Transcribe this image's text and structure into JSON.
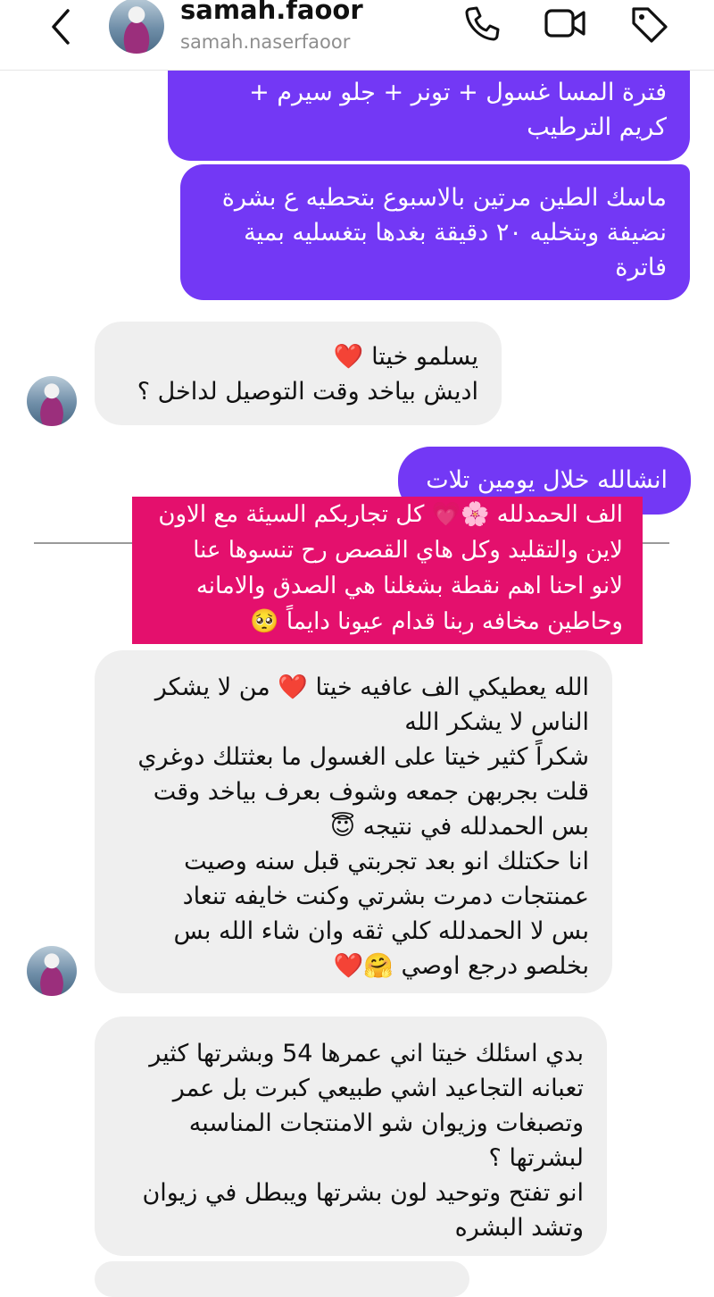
{
  "header": {
    "name": "samah.faoor",
    "username": "samah.naserfaoor"
  },
  "messages": [
    {
      "side": "sent",
      "lines": [
        "فترة المسا   غسول  + تونر + جلو سيرم +",
        "كريم الترطيب"
      ]
    },
    {
      "side": "sent",
      "lines": [
        "ماسك الطين مرتين بالاسبوع بتحطيه ع بشرة",
        "نضيفة وبتخليه ٢٠ دقيقة بغدها بتغسليه بمية",
        "فاترة"
      ]
    },
    {
      "side": "received",
      "lines": [
        "يسلمو خيتا ❤️",
        "اديش بياخد وقت التوصيل لداخل ؟"
      ]
    },
    {
      "side": "sent",
      "lines": [
        "انشالله خلال يومين تلات"
      ]
    },
    {
      "side": "received",
      "lines": [
        "الله يعطيكي الف عافيه خيتا ❤️ من لا يشكر",
        "الناس لا يشكر الله",
        "شكراً كثير خيتا على الغسول ما بعثتلك دوغري",
        "قلت بجربهن جمعه وشوف بعرف بياخد وقت",
        "بس الحمدلله في نتيجه 😇",
        "انا حكتلك انو بعد تجربتي قبل سنه وصيت",
        "عمنتجات دمرت بشرتي وكنت خايفه تنعاد",
        "بس لا الحمدلله كلي ثقه وان شاء الله بس",
        "بخلصو درجع اوصي 🤗❤️"
      ]
    },
    {
      "side": "received",
      "lines": [
        "بدي اسئلك خيتا  اني عمرها 54 وبشرتها كثير",
        "تعبانه  التجاعيد اشي طبيعي كبرت بل عمر",
        "وتصبغات وزيوان شو الامنتجات المناسبه",
        "لبشرتها ؟",
        "انو تفتح وتوحيد لون بشرتها ويبطل في زيوان",
        "وتشد البشره"
      ]
    }
  ],
  "overlay": {
    "lines": [
      "الف الحمدلله 🌸💗 كل تجاربكم السيئة مع الاون",
      "لاين والتقليد وكل هاي القصص رح تنسوها عنا",
      "لانو احنا اهم نقطة بشغلنا هي الصدق والامانه",
      "وحاطين مخافه ربنا قدام عيونا دايماً 🥺"
    ]
  }
}
